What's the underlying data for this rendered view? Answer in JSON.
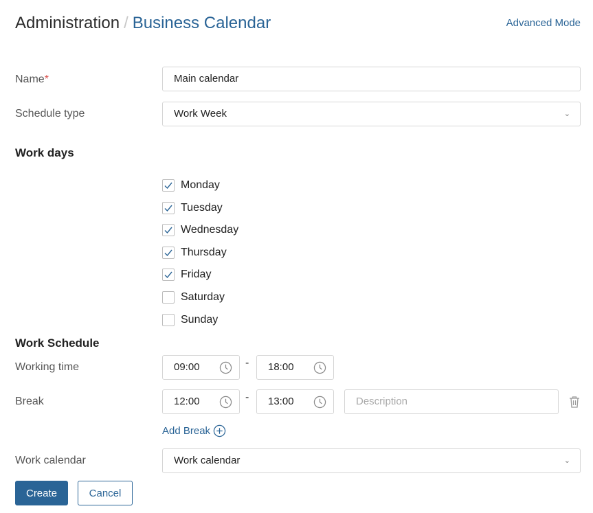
{
  "header": {
    "root": "Administration",
    "separator": "/",
    "current": "Business Calendar",
    "advanced_mode": "Advanced Mode"
  },
  "name": {
    "label": "Name",
    "required_mark": "*",
    "value": "Main calendar"
  },
  "schedule_type": {
    "label": "Schedule type",
    "value": "Work Week"
  },
  "work_days": {
    "title": "Work days",
    "days": [
      {
        "label": "Monday",
        "checked": true
      },
      {
        "label": "Tuesday",
        "checked": true
      },
      {
        "label": "Wednesday",
        "checked": true
      },
      {
        "label": "Thursday",
        "checked": true
      },
      {
        "label": "Friday",
        "checked": true
      },
      {
        "label": "Saturday",
        "checked": false
      },
      {
        "label": "Sunday",
        "checked": false
      }
    ]
  },
  "work_schedule": {
    "title": "Work Schedule",
    "working_time": {
      "label": "Working time",
      "from": "09:00",
      "to": "18:00",
      "separator": "-"
    },
    "break": {
      "label": "Break",
      "from": "12:00",
      "to": "13:00",
      "separator": "-",
      "description_placeholder": "Description"
    },
    "add_break": "Add Break"
  },
  "work_calendar": {
    "label": "Work calendar",
    "value": "Work calendar"
  },
  "buttons": {
    "create": "Create",
    "cancel": "Cancel"
  },
  "colors": {
    "accent": "#2a6496",
    "required": "#d9534f"
  }
}
